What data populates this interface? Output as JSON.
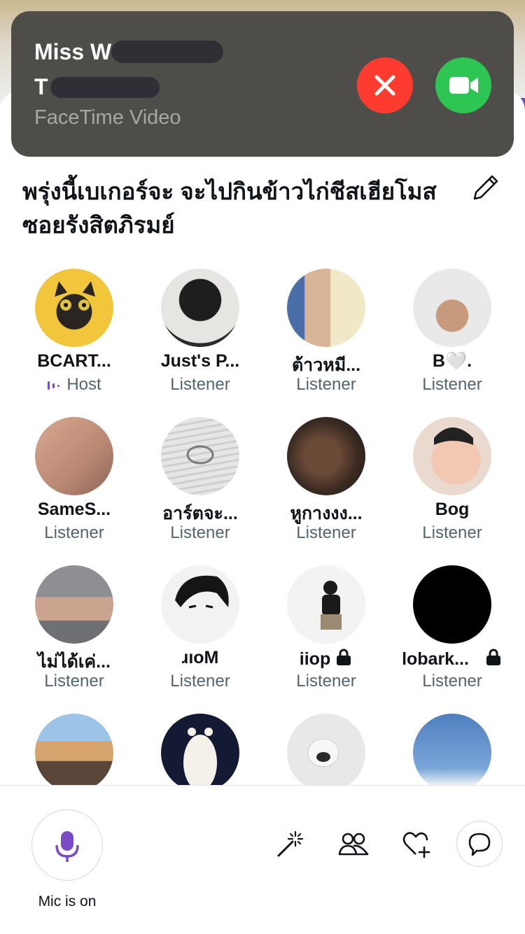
{
  "facetime": {
    "caller_line1": "Miss W",
    "caller_line2": "T",
    "subtitle": "FaceTime Video"
  },
  "space": {
    "title": "พรุ่งนี้เบเกอร์จะ จะไปกินข้าวไก่ชีสเฮียโมส ซอยรังสิตภิรมย์"
  },
  "participants": [
    {
      "name": "BCART...",
      "role": "Host"
    },
    {
      "name": "Just's P...",
      "role": "Listener"
    },
    {
      "name": "ต้าวหมี...",
      "role": "Listener"
    },
    {
      "name": "B🤍.",
      "role": "Listener"
    },
    {
      "name": "SameS...",
      "role": "Listener"
    },
    {
      "name": "อาร์ตจะ...",
      "role": "Listener"
    },
    {
      "name": "หูกางงง...",
      "role": "Listener"
    },
    {
      "name": "Bog",
      "role": "Listener"
    },
    {
      "name": "ไม่ได้เค่...",
      "role": "Listener"
    },
    {
      "name": "ɹıoM",
      "role": "Listener"
    },
    {
      "name": "iiop",
      "role": "Listener"
    },
    {
      "name": "lobark...",
      "role": "Listener"
    },
    {
      "name": "",
      "role": ""
    },
    {
      "name": "",
      "role": ""
    },
    {
      "name": "",
      "role": ""
    },
    {
      "name": "",
      "role": ""
    }
  ],
  "controls": {
    "mic_label": "Mic is on"
  },
  "colors": {
    "accent": "#794bc4",
    "decline": "#ff3b30",
    "accept": "#2dc653"
  }
}
